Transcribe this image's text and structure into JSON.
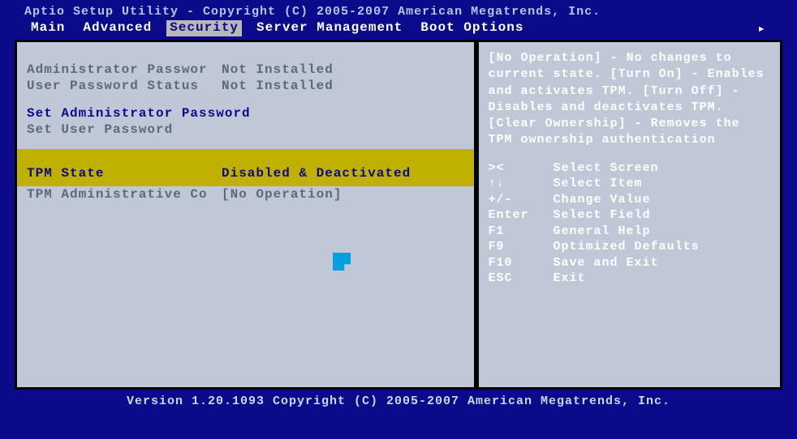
{
  "header": {
    "copyright": "Aptio Setup Utility - Copyright (C) 2005-2007 American Megatrends, Inc.",
    "tabs": [
      "Main",
      "Advanced",
      "Security",
      "Server Management",
      "Boot Options"
    ],
    "active_tab": "Security"
  },
  "left": {
    "admin_pw_label": "Administrator Passwor",
    "admin_pw_value": "Not Installed",
    "user_pw_label": "User Password Status",
    "user_pw_value": "Not Installed",
    "set_admin": "Set Administrator Password",
    "set_user": "Set User Password",
    "tpm_state_label": "TPM State",
    "tpm_state_value": "Disabled & Deactivated",
    "tpm_admin_label": "TPM Administrative Co",
    "tpm_admin_value": "[No Operation]"
  },
  "right": {
    "help": "[No Operation] - No changes to current state. [Turn On] - Enables and activates TPM. [Turn Off] - Disables and deactivates TPM. [Clear Ownership] - Removes the TPM ownership authentication",
    "keys": [
      {
        "k": "><",
        "d": "Select Screen"
      },
      {
        "k": "↑↓",
        "d": "Select Item"
      },
      {
        "k": "+/-",
        "d": "Change Value"
      },
      {
        "k": "Enter",
        "d": "Select Field"
      },
      {
        "k": "F1",
        "d": "General Help"
      },
      {
        "k": "F9",
        "d": "Optimized Defaults"
      },
      {
        "k": "F10",
        "d": "Save and Exit"
      },
      {
        "k": "ESC",
        "d": "Exit"
      }
    ]
  },
  "footer": "Version 1.20.1093 Copyright (C) 2005-2007 American Megatrends, Inc."
}
